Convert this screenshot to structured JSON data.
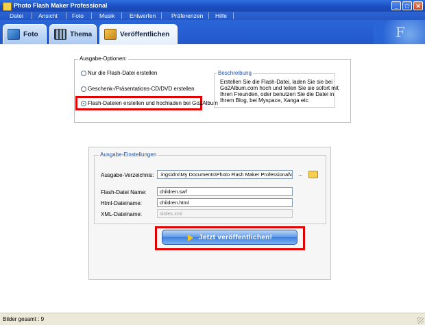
{
  "window": {
    "title": "Photo Flash Maker Professional",
    "min": "_",
    "max": "□",
    "close": "✕"
  },
  "menu": [
    "Datei",
    "Ansicht",
    "Foto",
    "Musik",
    "Entwerfen",
    "Präferenzen",
    "Hilfe"
  ],
  "tabs": [
    {
      "label": "Foto",
      "icon": "photos-icon"
    },
    {
      "label": "Thema",
      "icon": "filmstrip-icon"
    },
    {
      "label": "Veröffentlichen",
      "icon": "publish-icon",
      "active": true
    }
  ],
  "deco_text": "F",
  "output_options": {
    "legend": "Ausgabe-Optionen:",
    "options": [
      {
        "label": "Nur die Flash-Datei erstellen",
        "selected": false
      },
      {
        "label": "Geschenk-/Präsentations-CD/DVD erstellen",
        "selected": false
      },
      {
        "label": "Flash-Dateien erstellen und hochladen bei Go2Album",
        "selected": true
      }
    ],
    "description": {
      "legend": "Beschreibung",
      "lines": [
        "Erstellen Sie die Flash-Datei, laden Sie sie bei",
        "Go2Album.com hoch und teilen Sie sie sofort mit",
        "Ihren Freunden, oder benutzen Sie die Datei in",
        "Ihrem Blog, bei Myspace, Xanga etc."
      ]
    }
  },
  "output_settings": {
    "legend": "Ausgabe-Einstellungen",
    "directory_label": "Ausgabe-Verzeichnis:",
    "directory_value": ":ings\\drx\\My Documents\\Photo Flash Maker Professional\\output\\",
    "browse_label": "...",
    "flash_label": "Flash-Datei Name:",
    "flash_value": "children.swf",
    "html_label": "Html-Dateiname:",
    "html_value": "children.html",
    "xml_label": "XML-Dateiname:",
    "xml_value": "slides.xml"
  },
  "publish_button": "Jetzt veröffentlichen!",
  "status": {
    "text": "Bilder gesamt : 9"
  },
  "colors": {
    "highlight": "#e30000",
    "titlebar": "#1a4fc0",
    "button": "#3c7fdd"
  }
}
